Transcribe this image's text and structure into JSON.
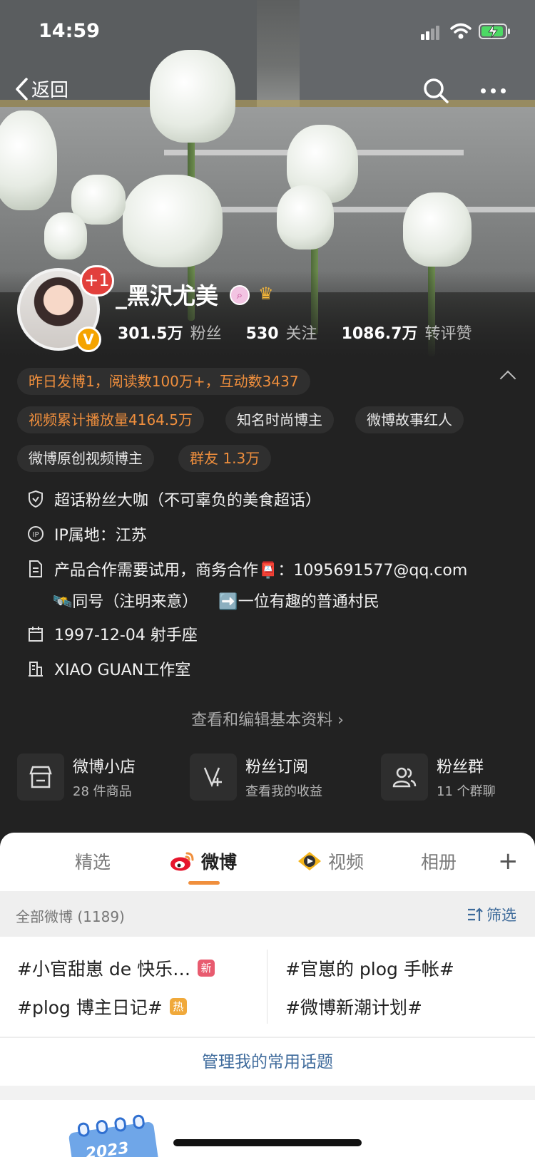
{
  "status_bar": {
    "time": "14:59"
  },
  "nav": {
    "back_label": "返回"
  },
  "profile": {
    "name": "_黑沢尤美",
    "plus_badge": "+1",
    "verified_badge": "V",
    "stats": [
      {
        "value": "301.5万",
        "label": "粉丝"
      },
      {
        "value": "530",
        "label": "关注"
      },
      {
        "value": "1086.7万",
        "label": "转评赞"
      }
    ]
  },
  "highlights": {
    "summary": "昨日发博1，阅读数100万+，互动数3437",
    "chips": [
      "视频累计播放量4164.5万",
      "知名时尚博主",
      "微博故事红人",
      "微博原创视频博主",
      "群友 1.3万"
    ]
  },
  "info": {
    "super_topic": "超话粉丝大咖（不可辜负的美食超话）",
    "ip": "IP属地：江苏",
    "bio_line1": "产品合作需要试用，商务合作📮：1095691577@qq.com",
    "bio_line2a": "🛰️同号（注明来意）",
    "bio_line2b": "➡️一位有趣的普通村民",
    "birthday": "1997-12-04 射手座",
    "company": "XIAO GUAN工作室"
  },
  "edit_link": "查看和编辑基本资料 ›",
  "services": [
    {
      "title": "微博小店",
      "sub": "28 件商品"
    },
    {
      "title": "粉丝订阅",
      "sub": "查看我的收益"
    },
    {
      "title": "粉丝群",
      "sub": "11 个群聊"
    }
  ],
  "tabs": [
    {
      "label": "精选"
    },
    {
      "label": "微博"
    },
    {
      "label": "视频"
    },
    {
      "label": "相册"
    }
  ],
  "filter": {
    "all": "全部微博 (1189)",
    "filter_label": "筛选"
  },
  "topics": {
    "left1": "#小官甜崽 de 快乐…",
    "left1_tag": "新",
    "left2": "#plog 博主日记#",
    "left2_tag": "热",
    "right1": "#官崽的 plog 手帐#",
    "right2": "#微博新潮计划#"
  },
  "manage_topics": "管理我的常用话题",
  "calendar_year": "2023",
  "colors": {
    "accent_orange": "#f08f3d",
    "link_blue": "#3f6b9c",
    "dark_bg": "#222222"
  }
}
